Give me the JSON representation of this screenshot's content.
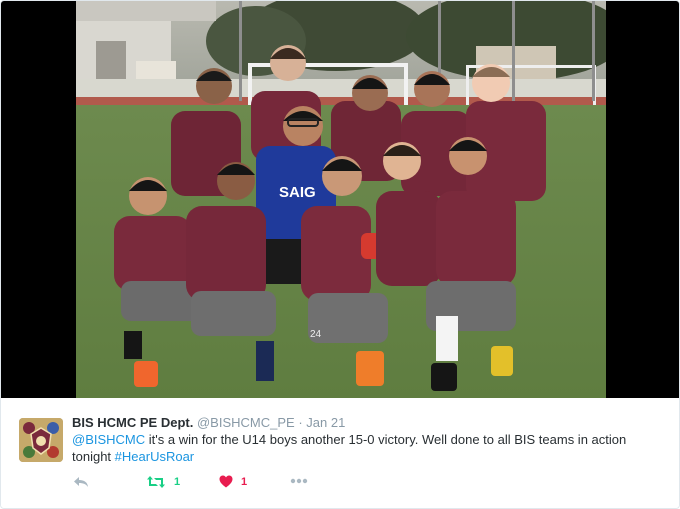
{
  "tweet": {
    "display_name": "BIS HCMC PE Dept.",
    "handle": "@BISHCMC_PE",
    "separator": "·",
    "date": "Jan 21",
    "text_mention": "@BISHCMC",
    "text_body": " it's a win for the U14 boys another 15-0 victory. Well done to all BIS teams in action tonight ",
    "hashtag": "#HearUsRoar"
  },
  "actions": {
    "retweet_count": "1",
    "like_count": "1"
  },
  "photo": {
    "jersey_text": "SAIG",
    "shorts_number": "24"
  },
  "colors": {
    "link": "#1b95e0",
    "retweet_green": "#19cf86",
    "like_red": "#e81c4f",
    "muted": "#8899a6",
    "jersey_maroon": "#7a2a3a",
    "goalkeeper_blue": "#1f3a9b",
    "grass_green": "#6d8e4a"
  },
  "icons": [
    "reply-icon",
    "retweet-icon",
    "heart-icon",
    "more-icon"
  ]
}
